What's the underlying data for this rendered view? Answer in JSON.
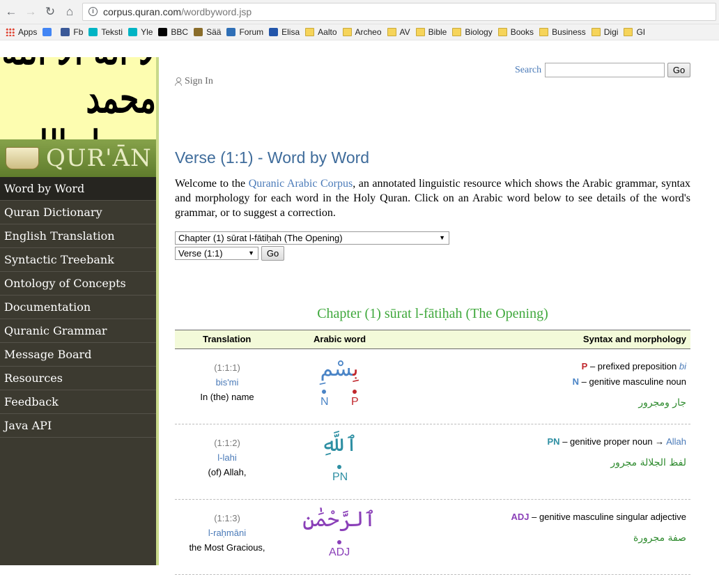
{
  "browser": {
    "url_host": "corpus.quran.com",
    "url_path": "/wordbyword.jsp",
    "bookmarks": [
      {
        "label": "Apps",
        "icon": "apps-icon",
        "color": "#e04a3a"
      },
      {
        "label": "",
        "icon": "google-icon",
        "color": "#4285f4"
      },
      {
        "label": "Fb",
        "icon": "facebook-icon",
        "color": "#3b5998"
      },
      {
        "label": "Teksti",
        "icon": "yle-icon",
        "color": "#00b4c4"
      },
      {
        "label": "Yle",
        "icon": "yle-icon",
        "color": "#00b4c4"
      },
      {
        "label": "BBC",
        "icon": "bbc-icon",
        "color": "#000000"
      },
      {
        "label": "Sää",
        "icon": "weather-icon",
        "color": "#8a6d2a"
      },
      {
        "label": "Forum",
        "icon": "forum-icon",
        "color": "#2f6fb6"
      },
      {
        "label": "Elisa",
        "icon": "elisa-icon",
        "color": "#2255aa"
      },
      {
        "label": "Aalto",
        "icon": "folder-icon",
        "color": "#f6d45a"
      },
      {
        "label": "Archeo",
        "icon": "folder-icon",
        "color": "#f6d45a"
      },
      {
        "label": "AV",
        "icon": "folder-icon",
        "color": "#f6d45a"
      },
      {
        "label": "Bible",
        "icon": "folder-icon",
        "color": "#f6d45a"
      },
      {
        "label": "Biology",
        "icon": "folder-icon",
        "color": "#f6d45a"
      },
      {
        "label": "Books",
        "icon": "folder-icon",
        "color": "#f6d45a"
      },
      {
        "label": "Business",
        "icon": "folder-icon",
        "color": "#f6d45a"
      },
      {
        "label": "Digi",
        "icon": "folder-icon",
        "color": "#f6d45a"
      },
      {
        "label": "GI",
        "icon": "folder-icon",
        "color": "#f6d45a"
      }
    ]
  },
  "sidebar": {
    "calligraphy": "لا اله الا الله محمد رسول الله",
    "logo_text": "QUR'ĀN",
    "items": [
      {
        "label": "Word by Word",
        "active": true
      },
      {
        "label": "Quran Dictionary",
        "active": false
      },
      {
        "label": "English Translation",
        "active": false
      },
      {
        "label": "Syntactic Treebank",
        "active": false
      },
      {
        "label": "Ontology of Concepts",
        "active": false
      },
      {
        "label": "Documentation",
        "active": false
      },
      {
        "label": "Quranic Grammar",
        "active": false
      },
      {
        "label": "Message Board",
        "active": false
      },
      {
        "label": "Resources",
        "active": false
      },
      {
        "label": "Feedback",
        "active": false
      },
      {
        "label": "Java API",
        "active": false
      }
    ]
  },
  "header": {
    "sign_in": "Sign In",
    "search_label": "Search",
    "search_value": "",
    "search_button": "Go"
  },
  "main": {
    "title": "Verse (1:1) - Word by Word",
    "intro_before": "Welcome to the ",
    "intro_link": "Quranic Arabic Corpus",
    "intro_after": ", an annotated linguistic resource which shows the Arabic grammar, syntax and morphology for each word in the Holy Quran. Click on an Arabic word below to see details of the word's grammar, or to suggest a correction.",
    "chapter_select": "Chapter (1) sūrat l-fātiḥah (The Opening)",
    "verse_select": "Verse (1:1)",
    "go_button": "Go",
    "chapter_heading": "Chapter (1) sūrat l-fātiḥah (The Opening)"
  },
  "table": {
    "headers": {
      "translation": "Translation",
      "arabic": "Arabic word",
      "syntax": "Syntax and morphology"
    },
    "rows": [
      {
        "location": "(1:1:1)",
        "transliteration": "bis'mi",
        "translation": "In (the) name",
        "arabic_segments": [
          {
            "text": "بِ",
            "tag": "P",
            "color": "#c0272d"
          },
          {
            "text": "سْمِ",
            "tag": "N",
            "color": "#4a84c6"
          }
        ],
        "syntax": [
          {
            "tag": "P",
            "tag_color": "#c0272d",
            "desc": " – prefixed preposition ",
            "extra": "bi",
            "extra_color": "#4a7ab8",
            "extra_italic": true
          },
          {
            "tag": "N",
            "tag_color": "#4a84c6",
            "desc": " – genitive masculine noun",
            "extra": "",
            "extra_color": "",
            "extra_italic": false
          }
        ],
        "arabic_syntax": "جار ومجرور"
      },
      {
        "location": "(1:1:2)",
        "transliteration": "l-lahi",
        "translation": "(of) Allah,",
        "arabic_segments": [
          {
            "text": "ٱللَّهِ",
            "tag": "PN",
            "color": "#2e8fa3"
          }
        ],
        "syntax": [
          {
            "tag": "PN",
            "tag_color": "#2e8fa3",
            "desc": " – genitive proper noun → ",
            "extra": "Allah",
            "extra_color": "#4a7ab8",
            "extra_italic": false
          }
        ],
        "arabic_syntax": "لفظ الجلالة مجرور"
      },
      {
        "location": "(1:1:3)",
        "transliteration": "l-raḥmāni",
        "translation": "the Most Gracious,",
        "arabic_segments": [
          {
            "text": "ٱلرَّحْمَٰنِ",
            "tag": "ADJ",
            "color": "#8a3fb8"
          }
        ],
        "syntax": [
          {
            "tag": "ADJ",
            "tag_color": "#8a3fb8",
            "desc": " – genitive masculine singular adjective",
            "extra": "",
            "extra_color": "",
            "extra_italic": false
          }
        ],
        "arabic_syntax": "صفة مجرورة"
      }
    ]
  }
}
